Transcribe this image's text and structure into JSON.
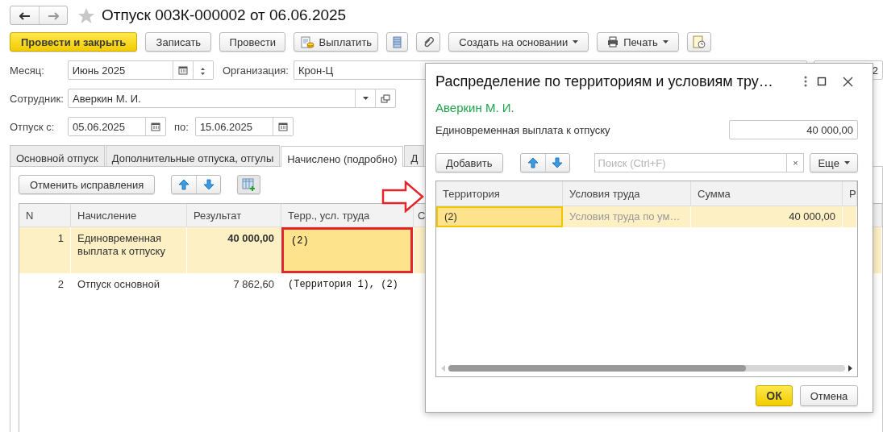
{
  "window": {
    "title": "Отпуск 003К-000002 от 06.06.2025"
  },
  "toolbar": [
    {
      "kind": "primary",
      "label": "Провести и закрыть"
    },
    {
      "kind": "plain",
      "label": "Записать"
    },
    {
      "kind": "plain",
      "label": "Провести"
    },
    {
      "kind": "pay",
      "label": "Выплатить"
    },
    {
      "kind": "list"
    },
    {
      "kind": "clip"
    },
    {
      "kind": "menu",
      "label": "Создать на основании"
    },
    {
      "kind": "print",
      "label": "Печать"
    },
    {
      "kind": "report"
    }
  ],
  "month": {
    "label": "Месяц:",
    "value": "Июнь 2025"
  },
  "organization": {
    "label": "Организация:",
    "value": "Крон-Ц"
  },
  "field_3": {
    "value": "2"
  },
  "employee": {
    "label": "Сотрудник:",
    "value": "Аверкин М. И."
  },
  "period": {
    "label": "Отпуск с:",
    "from": "05.06.2025",
    "to_label": "по:",
    "to": "15.06.2025"
  },
  "tabs": [
    {
      "label": "Основной отпуск",
      "selected": false
    },
    {
      "label": "Дополнительные отпуска, отгулы",
      "selected": false
    },
    {
      "label": "Начислено (подробно)",
      "selected": true
    },
    {
      "label": "Д",
      "selected": false
    }
  ],
  "panel_toolbar": {
    "cancel": "Отменить исправления"
  },
  "table": {
    "columns": [
      "N",
      "Начисление",
      "Результат",
      "Терр., усл. труда",
      "С"
    ],
    "rows": [
      {
        "n": "1",
        "accrual": "Единовременная выплата к отпуску",
        "result": "40 000,00",
        "territory": "(2)",
        "selected": true,
        "marked": true
      },
      {
        "n": "2",
        "accrual": "Отпуск основной",
        "result": "7 862,60",
        "territory": "(Территория 1), (2)",
        "selected": false,
        "marked": false
      }
    ]
  },
  "dialog": {
    "title": "Распределение по территориям и условиям тру…",
    "employee": "Аверкин М. И.",
    "amount_label": "Единовременная выплата к отпуску",
    "amount": "40 000,00",
    "add": "Добавить",
    "search": {
      "placeholder": "Поиск (Ctrl+F)",
      "clear": "×"
    },
    "more": "Еще",
    "columns": [
      "Территория",
      "Условия труда",
      "Сумма",
      "Р"
    ],
    "rows": [
      {
        "territory": "(2)",
        "conditions": "Условия труда по ум…",
        "amount": "40 000,00",
        "selected": true
      }
    ],
    "buttons": [
      {
        "kind": "primary",
        "label": "ОК"
      },
      {
        "kind": "plain",
        "label": "Отмена"
      }
    ]
  }
}
